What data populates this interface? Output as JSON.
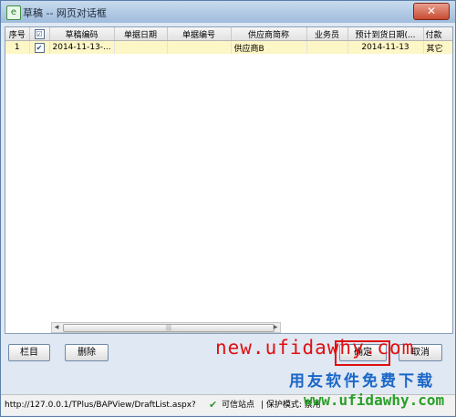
{
  "window": {
    "title": "草稿 -- 网页对话框",
    "close_symbol": "✕"
  },
  "table": {
    "headers": [
      "序号",
      "☑",
      "草稿编码",
      "单据日期",
      "单据编号",
      "供应商简称",
      "业务员",
      "预计到货日期(...",
      "付款"
    ],
    "rows": [
      {
        "seq": "1",
        "checked": true,
        "draft_code": "2014-11-13-...",
        "doc_date": "",
        "doc_no": "",
        "supplier": "供应商B",
        "salesman": "",
        "expected_date": "2014-11-13",
        "payment": "其它"
      }
    ]
  },
  "scrollbar": {
    "left_arrow": "◀",
    "right_arrow": "▶",
    "thumb_grip": "|||"
  },
  "buttons": {
    "columns": "栏目",
    "delete": "删除",
    "ok": "确定",
    "cancel": "取消"
  },
  "status": {
    "url": "http://127.0.0.1/TPlus/BAPView/DraftList.aspx?",
    "trust_icon": "✔",
    "trust_label": "可信站点",
    "protect_label": "| 保护模式: 禁用"
  },
  "watermarks": {
    "top": "new.ufidawhy.com",
    "brand": "用友软件免费下载",
    "bottom": "www.ufidawhy.com"
  }
}
